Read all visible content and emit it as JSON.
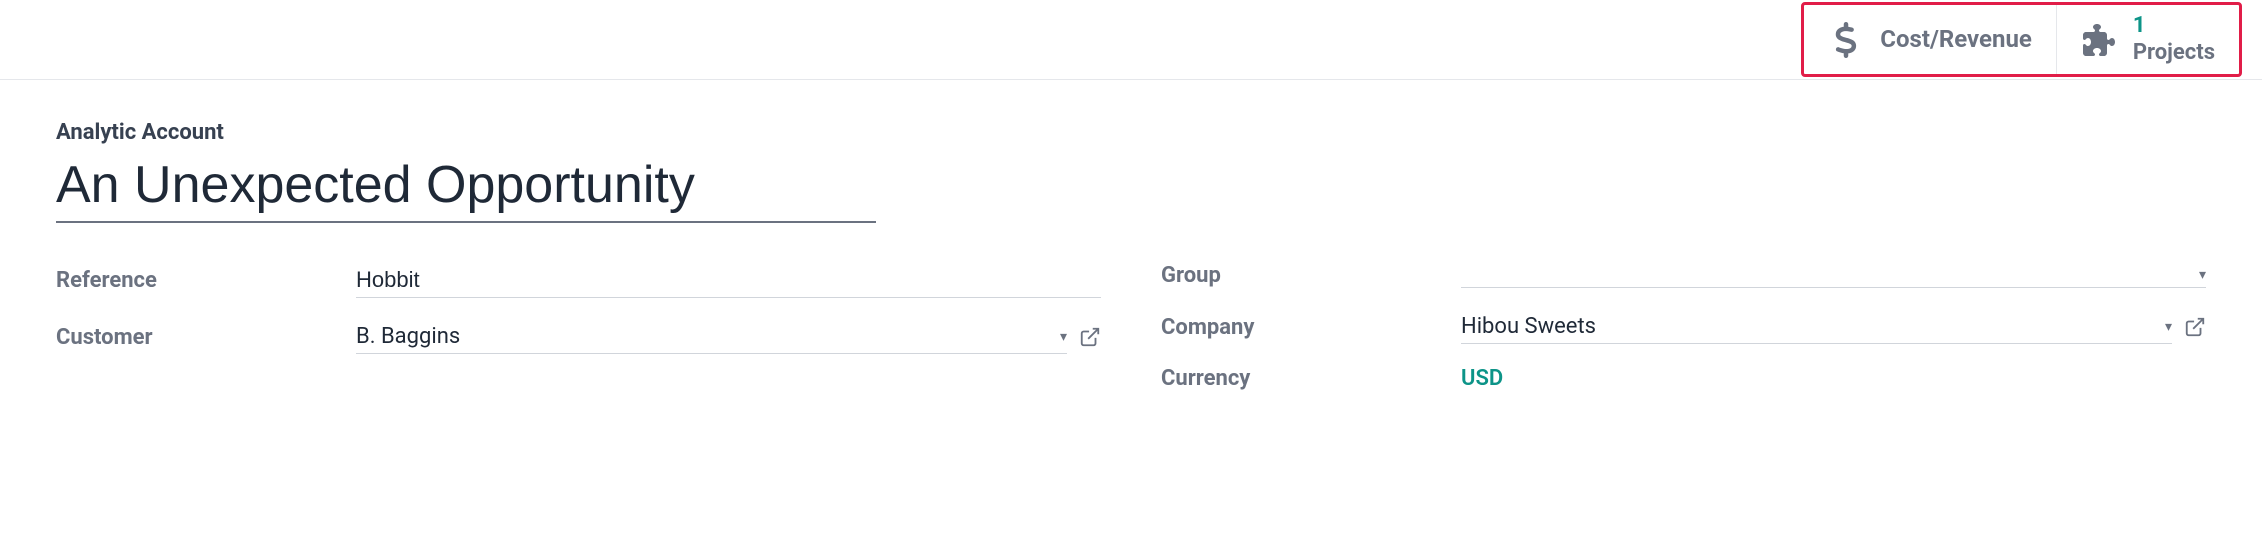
{
  "topbar": {
    "cost_revenue_label": "Cost/Revenue",
    "projects_count": "1",
    "projects_label": "Projects"
  },
  "record": {
    "type_label": "Analytic Account",
    "title": "An Unexpected Opportunity"
  },
  "fields": {
    "reference_label": "Reference",
    "reference_value": "Hobbit",
    "customer_label": "Customer",
    "customer_value": "B. Baggins",
    "group_label": "Group",
    "group_value": "",
    "company_label": "Company",
    "company_value": "Hibou Sweets",
    "currency_label": "Currency",
    "currency_value": "USD"
  }
}
